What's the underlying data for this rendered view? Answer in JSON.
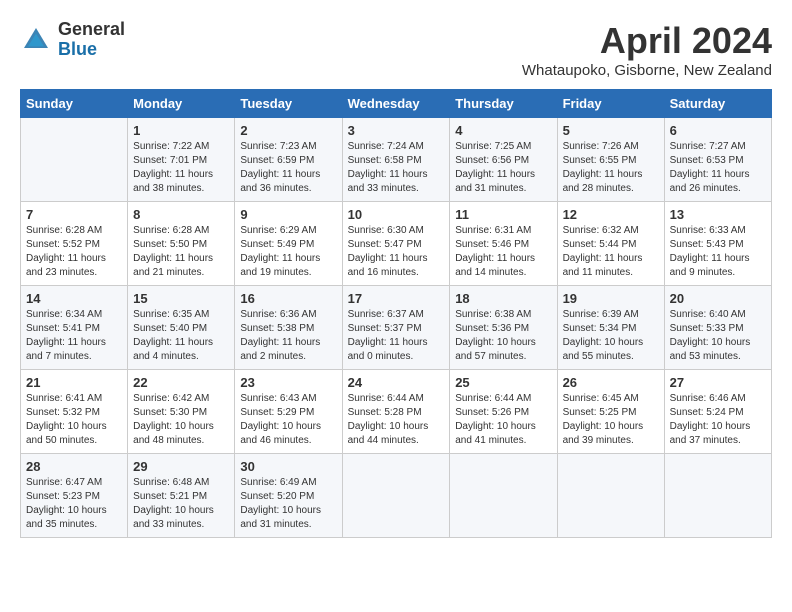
{
  "header": {
    "logo_general": "General",
    "logo_blue": "Blue",
    "title": "April 2024",
    "location": "Whataupoko, Gisborne, New Zealand"
  },
  "columns": [
    "Sunday",
    "Monday",
    "Tuesday",
    "Wednesday",
    "Thursday",
    "Friday",
    "Saturday"
  ],
  "weeks": [
    [
      {
        "day": "",
        "sunrise": "",
        "sunset": "",
        "daylight": ""
      },
      {
        "day": "1",
        "sunrise": "Sunrise: 7:22 AM",
        "sunset": "Sunset: 7:01 PM",
        "daylight": "Daylight: 11 hours and 38 minutes."
      },
      {
        "day": "2",
        "sunrise": "Sunrise: 7:23 AM",
        "sunset": "Sunset: 6:59 PM",
        "daylight": "Daylight: 11 hours and 36 minutes."
      },
      {
        "day": "3",
        "sunrise": "Sunrise: 7:24 AM",
        "sunset": "Sunset: 6:58 PM",
        "daylight": "Daylight: 11 hours and 33 minutes."
      },
      {
        "day": "4",
        "sunrise": "Sunrise: 7:25 AM",
        "sunset": "Sunset: 6:56 PM",
        "daylight": "Daylight: 11 hours and 31 minutes."
      },
      {
        "day": "5",
        "sunrise": "Sunrise: 7:26 AM",
        "sunset": "Sunset: 6:55 PM",
        "daylight": "Daylight: 11 hours and 28 minutes."
      },
      {
        "day": "6",
        "sunrise": "Sunrise: 7:27 AM",
        "sunset": "Sunset: 6:53 PM",
        "daylight": "Daylight: 11 hours and 26 minutes."
      }
    ],
    [
      {
        "day": "7",
        "sunrise": "Sunrise: 6:28 AM",
        "sunset": "Sunset: 5:52 PM",
        "daylight": "Daylight: 11 hours and 23 minutes."
      },
      {
        "day": "8",
        "sunrise": "Sunrise: 6:28 AM",
        "sunset": "Sunset: 5:50 PM",
        "daylight": "Daylight: 11 hours and 21 minutes."
      },
      {
        "day": "9",
        "sunrise": "Sunrise: 6:29 AM",
        "sunset": "Sunset: 5:49 PM",
        "daylight": "Daylight: 11 hours and 19 minutes."
      },
      {
        "day": "10",
        "sunrise": "Sunrise: 6:30 AM",
        "sunset": "Sunset: 5:47 PM",
        "daylight": "Daylight: 11 hours and 16 minutes."
      },
      {
        "day": "11",
        "sunrise": "Sunrise: 6:31 AM",
        "sunset": "Sunset: 5:46 PM",
        "daylight": "Daylight: 11 hours and 14 minutes."
      },
      {
        "day": "12",
        "sunrise": "Sunrise: 6:32 AM",
        "sunset": "Sunset: 5:44 PM",
        "daylight": "Daylight: 11 hours and 11 minutes."
      },
      {
        "day": "13",
        "sunrise": "Sunrise: 6:33 AM",
        "sunset": "Sunset: 5:43 PM",
        "daylight": "Daylight: 11 hours and 9 minutes."
      }
    ],
    [
      {
        "day": "14",
        "sunrise": "Sunrise: 6:34 AM",
        "sunset": "Sunset: 5:41 PM",
        "daylight": "Daylight: 11 hours and 7 minutes."
      },
      {
        "day": "15",
        "sunrise": "Sunrise: 6:35 AM",
        "sunset": "Sunset: 5:40 PM",
        "daylight": "Daylight: 11 hours and 4 minutes."
      },
      {
        "day": "16",
        "sunrise": "Sunrise: 6:36 AM",
        "sunset": "Sunset: 5:38 PM",
        "daylight": "Daylight: 11 hours and 2 minutes."
      },
      {
        "day": "17",
        "sunrise": "Sunrise: 6:37 AM",
        "sunset": "Sunset: 5:37 PM",
        "daylight": "Daylight: 11 hours and 0 minutes."
      },
      {
        "day": "18",
        "sunrise": "Sunrise: 6:38 AM",
        "sunset": "Sunset: 5:36 PM",
        "daylight": "Daylight: 10 hours and 57 minutes."
      },
      {
        "day": "19",
        "sunrise": "Sunrise: 6:39 AM",
        "sunset": "Sunset: 5:34 PM",
        "daylight": "Daylight: 10 hours and 55 minutes."
      },
      {
        "day": "20",
        "sunrise": "Sunrise: 6:40 AM",
        "sunset": "Sunset: 5:33 PM",
        "daylight": "Daylight: 10 hours and 53 minutes."
      }
    ],
    [
      {
        "day": "21",
        "sunrise": "Sunrise: 6:41 AM",
        "sunset": "Sunset: 5:32 PM",
        "daylight": "Daylight: 10 hours and 50 minutes."
      },
      {
        "day": "22",
        "sunrise": "Sunrise: 6:42 AM",
        "sunset": "Sunset: 5:30 PM",
        "daylight": "Daylight: 10 hours and 48 minutes."
      },
      {
        "day": "23",
        "sunrise": "Sunrise: 6:43 AM",
        "sunset": "Sunset: 5:29 PM",
        "daylight": "Daylight: 10 hours and 46 minutes."
      },
      {
        "day": "24",
        "sunrise": "Sunrise: 6:44 AM",
        "sunset": "Sunset: 5:28 PM",
        "daylight": "Daylight: 10 hours and 44 minutes."
      },
      {
        "day": "25",
        "sunrise": "Sunrise: 6:44 AM",
        "sunset": "Sunset: 5:26 PM",
        "daylight": "Daylight: 10 hours and 41 minutes."
      },
      {
        "day": "26",
        "sunrise": "Sunrise: 6:45 AM",
        "sunset": "Sunset: 5:25 PM",
        "daylight": "Daylight: 10 hours and 39 minutes."
      },
      {
        "day": "27",
        "sunrise": "Sunrise: 6:46 AM",
        "sunset": "Sunset: 5:24 PM",
        "daylight": "Daylight: 10 hours and 37 minutes."
      }
    ],
    [
      {
        "day": "28",
        "sunrise": "Sunrise: 6:47 AM",
        "sunset": "Sunset: 5:23 PM",
        "daylight": "Daylight: 10 hours and 35 minutes."
      },
      {
        "day": "29",
        "sunrise": "Sunrise: 6:48 AM",
        "sunset": "Sunset: 5:21 PM",
        "daylight": "Daylight: 10 hours and 33 minutes."
      },
      {
        "day": "30",
        "sunrise": "Sunrise: 6:49 AM",
        "sunset": "Sunset: 5:20 PM",
        "daylight": "Daylight: 10 hours and 31 minutes."
      },
      {
        "day": "",
        "sunrise": "",
        "sunset": "",
        "daylight": ""
      },
      {
        "day": "",
        "sunrise": "",
        "sunset": "",
        "daylight": ""
      },
      {
        "day": "",
        "sunrise": "",
        "sunset": "",
        "daylight": ""
      },
      {
        "day": "",
        "sunrise": "",
        "sunset": "",
        "daylight": ""
      }
    ]
  ]
}
